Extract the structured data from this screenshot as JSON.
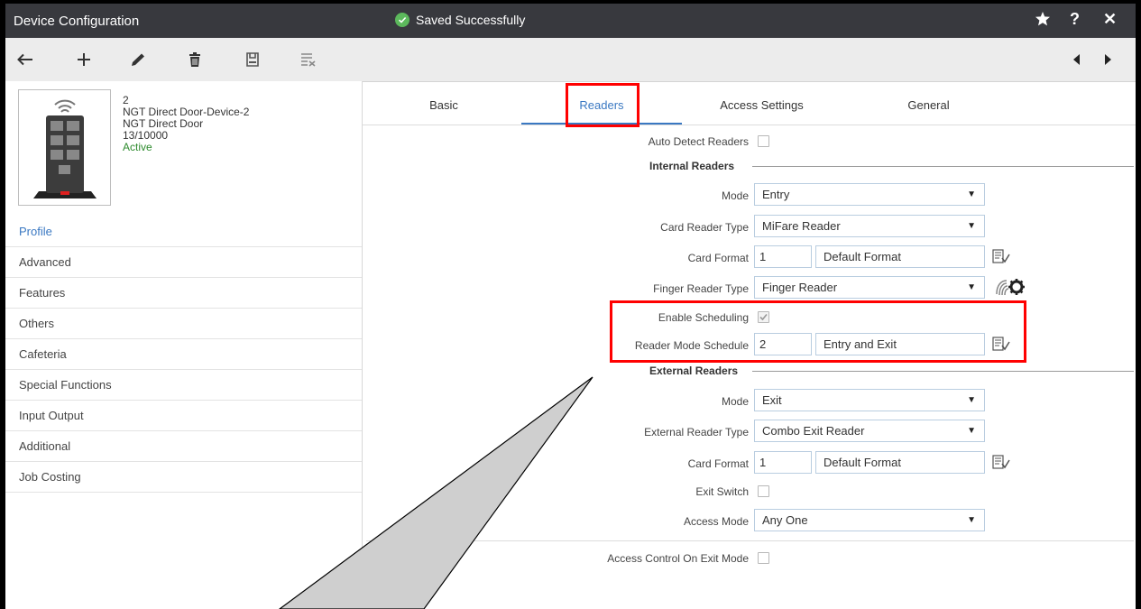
{
  "titlebar": {
    "title": "Device Configuration",
    "saved_message": "Saved Successfully",
    "icons": [
      "star-icon",
      "help-icon",
      "close-icon"
    ]
  },
  "toolbar": {
    "icons": [
      "back-arrow-icon",
      "add-icon",
      "edit-pen-icon",
      "delete-trash-icon",
      "save-icon",
      "clear-list-icon"
    ],
    "nav_icons": [
      "prev-arrow-icon",
      "next-arrow-icon"
    ]
  },
  "device": {
    "id": "2",
    "name": "NGT Direct Door-Device-2",
    "type": "NGT Direct Door",
    "count": "13/10000",
    "status": "Active"
  },
  "sidebar": {
    "items": [
      {
        "label": "Profile",
        "selected": true
      },
      {
        "label": "Advanced"
      },
      {
        "label": "Features"
      },
      {
        "label": "Others"
      },
      {
        "label": "Cafeteria"
      },
      {
        "label": "Special Functions"
      },
      {
        "label": "Input Output"
      },
      {
        "label": "Additional"
      },
      {
        "label": "Job Costing"
      }
    ]
  },
  "tabs": [
    {
      "label": "Basic"
    },
    {
      "label": "Readers",
      "active": true
    },
    {
      "label": "Access Settings"
    },
    {
      "label": "General"
    }
  ],
  "form": {
    "auto_detect_label": "Auto Detect Readers",
    "auto_detect_checked": false,
    "internal": {
      "section_title": "Internal Readers",
      "mode_label": "Mode",
      "mode_value": "Entry",
      "card_reader_type_label": "Card Reader Type",
      "card_reader_type_value": "MiFare Reader",
      "card_format_label": "Card Format",
      "card_format_code": "1",
      "card_format_name": "Default Format",
      "finger_reader_type_label": "Finger Reader Type",
      "finger_reader_type_value": "Finger Reader",
      "enable_scheduling_label": "Enable Scheduling",
      "enable_scheduling_checked": true,
      "reader_mode_schedule_label": "Reader Mode Schedule",
      "reader_mode_schedule_code": "2",
      "reader_mode_schedule_name": "Entry and Exit"
    },
    "external": {
      "section_title": "External Readers",
      "mode_label": "Mode",
      "mode_value": "Exit",
      "reader_type_label": "External Reader Type",
      "reader_type_value": "Combo Exit Reader",
      "card_format_label": "Card Format",
      "card_format_code": "1",
      "card_format_name": "Default Format",
      "exit_switch_label": "Exit Switch",
      "exit_switch_checked": false,
      "access_mode_label": "Access Mode",
      "access_mode_value": "Any One"
    },
    "access_control_exit_label": "Access Control On Exit Mode",
    "access_control_exit_checked": false
  },
  "colors": {
    "titlebar_bg": "#38393e",
    "accent": "#3a78c2",
    "highlight": "#ff0000",
    "status_active": "#2e8b2e"
  }
}
